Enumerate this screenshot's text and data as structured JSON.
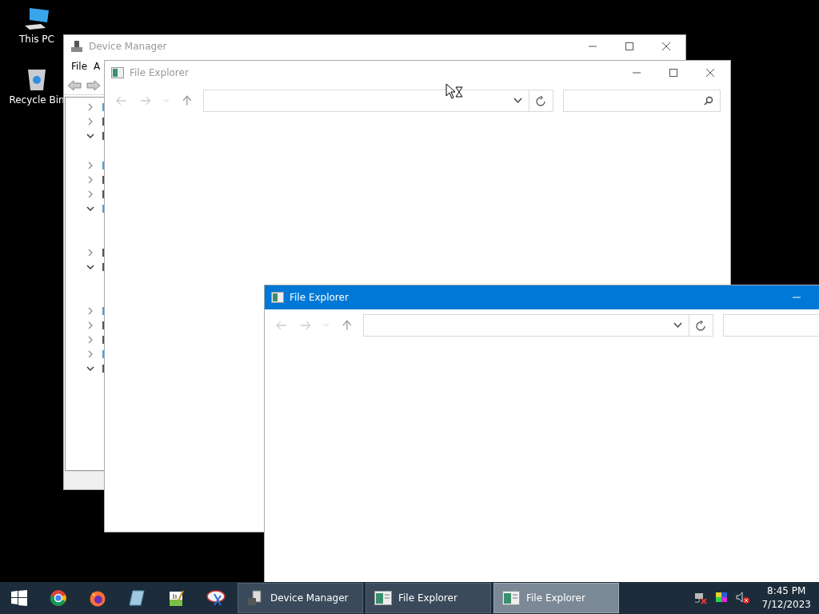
{
  "desktop_icons": [
    {
      "kind": "computer",
      "label": "This PC"
    },
    {
      "kind": "recycle",
      "label": "Recycle Bin"
    }
  ],
  "device_manager": {
    "title": "Device Manager",
    "active": false,
    "menu": [
      "File",
      "A"
    ],
    "tree": [
      {
        "expanded": false
      },
      {
        "expanded": false
      },
      {
        "expanded": true
      },
      {
        "expanded": false
      },
      {
        "expanded": false
      },
      {
        "expanded": false
      },
      {
        "expanded": true
      },
      {
        "expanded": false
      },
      {
        "expanded": true
      },
      {
        "expanded": false
      },
      {
        "expanded": false
      },
      {
        "expanded": false
      },
      {
        "expanded": false
      },
      {
        "expanded": true
      }
    ]
  },
  "explorers": [
    {
      "title": "File Explorer",
      "active": false
    },
    {
      "title": "File Explorer",
      "active": true
    }
  ],
  "taskbar": {
    "pinned": [
      {
        "kind": "chrome"
      },
      {
        "kind": "firefox"
      },
      {
        "kind": "notepad"
      },
      {
        "kind": "sheet"
      },
      {
        "kind": "snip"
      }
    ],
    "tasks": [
      {
        "kind": "devices",
        "label": "Device Manager",
        "selected": false
      },
      {
        "kind": "explorer",
        "label": "File Explorer",
        "selected": false
      },
      {
        "kind": "explorer",
        "label": "File Explorer",
        "selected": true
      }
    ],
    "tray": [
      {
        "kind": "network"
      },
      {
        "kind": "display"
      },
      {
        "kind": "volume"
      }
    ],
    "time": "8:45 PM",
    "date": "7/12/2023"
  }
}
